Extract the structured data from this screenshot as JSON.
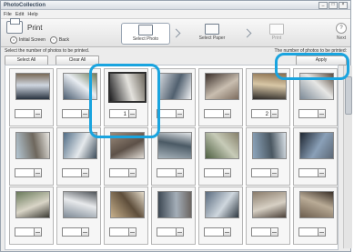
{
  "window": {
    "title": "PhotoCollection",
    "min": "_",
    "max": "□",
    "close": "×"
  },
  "menu": [
    "File",
    "Edit",
    "Help"
  ],
  "toolbar": {
    "print_label": "Print",
    "nav": [
      {
        "label": "Initial Screen",
        "icon": "home-icon"
      },
      {
        "label": "Back",
        "icon": "back-arrow-icon"
      }
    ],
    "steps": [
      {
        "label": "Select Photo",
        "icon": "photo-icon",
        "state": "active"
      },
      {
        "label": "Select Paper",
        "icon": "paper-icon",
        "state": "normal"
      },
      {
        "label": "Print",
        "icon": "printer-icon",
        "state": "disabled"
      }
    ],
    "help_label": "Next"
  },
  "info": {
    "left": "Select the number of photos to be printed.",
    "right": "The number of photos to be printed:"
  },
  "buttons": {
    "select_all": "Select All",
    "clear_all": "Clear All",
    "apply": "Apply"
  },
  "photos": [
    {
      "qty": "",
      "selected": false,
      "colors": [
        "#28323f",
        "#cfd6e0",
        "#7a6a58"
      ]
    },
    {
      "qty": "",
      "selected": false,
      "colors": [
        "#4a5c70",
        "#e9edf2",
        "#6e7b57"
      ]
    },
    {
      "qty": "1",
      "selected": true,
      "colors": [
        "#1d1d1f",
        "#e4e2dd",
        "#6b665c"
      ]
    },
    {
      "qty": "",
      "selected": false,
      "colors": [
        "#d9dde2",
        "#51606f",
        "#f3f4f6"
      ]
    },
    {
      "qty": "",
      "selected": false,
      "colors": [
        "#3a2f2a",
        "#c9beb0",
        "#7c6c5e"
      ]
    },
    {
      "qty": "2",
      "selected": false,
      "colors": [
        "#2d2a28",
        "#d8c7a6",
        "#8a6f4e"
      ]
    },
    {
      "qty": "",
      "selected": false,
      "colors": [
        "#7c8a97",
        "#e7e7e5",
        "#5b4c3f"
      ]
    },
    {
      "qty": "",
      "selected": false,
      "colors": [
        "#b5c8d5",
        "#6e675d",
        "#e8e6e1"
      ]
    },
    {
      "qty": "",
      "selected": false,
      "colors": [
        "#516d86",
        "#e5e9ec",
        "#3e4d5b"
      ]
    },
    {
      "qty": "",
      "selected": false,
      "colors": [
        "#9a8a7a",
        "#5d5148",
        "#e2ddd6"
      ]
    },
    {
      "qty": "",
      "selected": false,
      "colors": [
        "#a7b3bb",
        "#4b5a65",
        "#dfe3e6"
      ]
    },
    {
      "qty": "",
      "selected": false,
      "colors": [
        "#4d5f41",
        "#c7cbb8",
        "#86806a"
      ]
    },
    {
      "qty": "",
      "selected": false,
      "colors": [
        "#8ea6bd",
        "#4a5761",
        "#dde4ea"
      ]
    },
    {
      "qty": "",
      "selected": false,
      "colors": [
        "#1e2631",
        "#8aa0b8",
        "#5c6876"
      ]
    },
    {
      "qty": "",
      "selected": false,
      "colors": [
        "#6a7a5b",
        "#d9d5c7",
        "#3b3a33"
      ]
    },
    {
      "qty": "",
      "selected": false,
      "colors": [
        "#7e8a96",
        "#e8eaec",
        "#4e5358"
      ]
    },
    {
      "qty": "",
      "selected": false,
      "colors": [
        "#c7b08c",
        "#5e4e3b",
        "#e6ddcc"
      ]
    },
    {
      "qty": "",
      "selected": false,
      "colors": [
        "#3c4752",
        "#a4aeb8",
        "#6a6460"
      ]
    },
    {
      "qty": "",
      "selected": false,
      "colors": [
        "#5a6b7e",
        "#cfd7de",
        "#2f3942"
      ]
    },
    {
      "qty": "",
      "selected": false,
      "colors": [
        "#8a7c6b",
        "#d7d0c4",
        "#4a4038"
      ]
    },
    {
      "qty": "",
      "selected": false,
      "colors": [
        "#6c5d4d",
        "#b9ab96",
        "#3a3028"
      ]
    }
  ]
}
